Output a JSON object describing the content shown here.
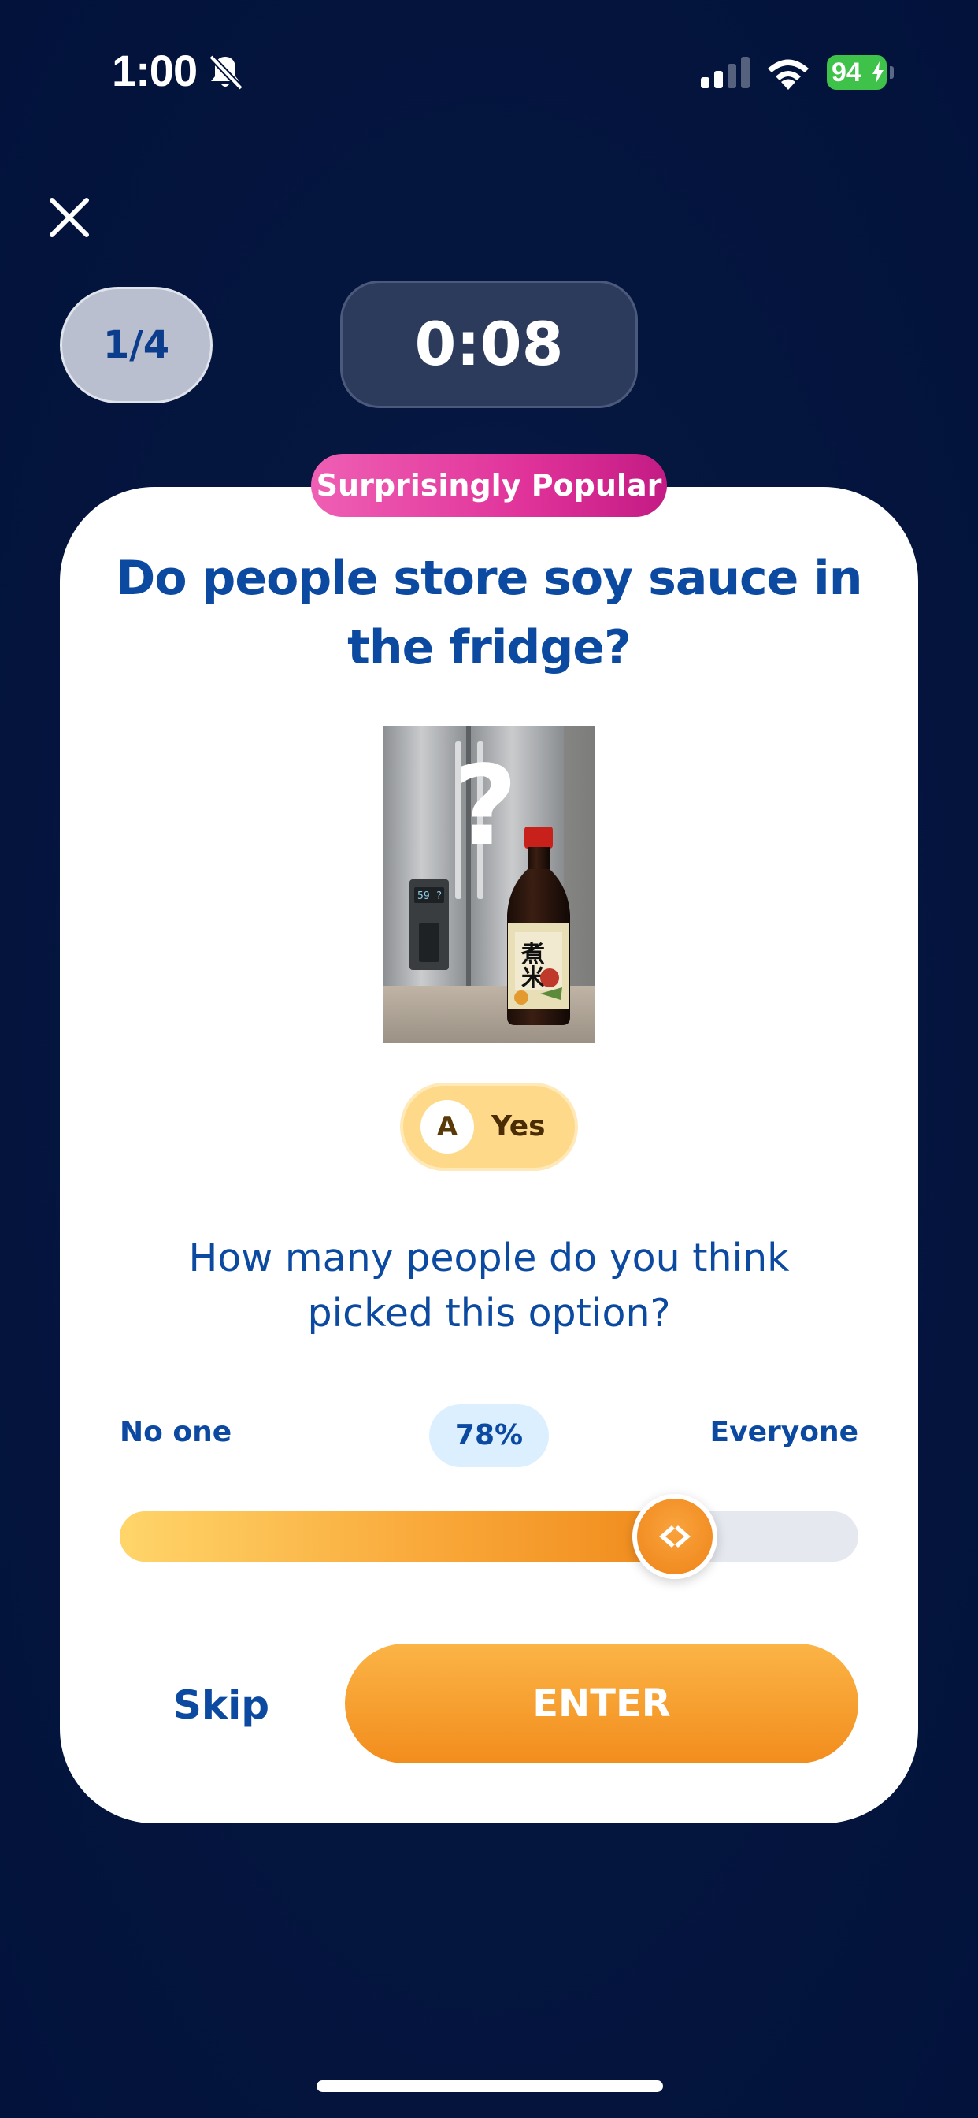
{
  "status_bar": {
    "time": "1:00",
    "battery_level": "94",
    "icons": [
      "bell-slash-icon",
      "cellular-signal-icon",
      "wifi-icon",
      "battery-charging-icon"
    ]
  },
  "header": {
    "close_icon": "close-icon",
    "progress": "1/4",
    "timer": "0:08"
  },
  "card": {
    "category": "Surprisingly Popular",
    "question": "Do people store soy sauce in the fridge?",
    "image_icon": "fridge-soy-sauce-photo",
    "option": {
      "letter": "A",
      "label": "Yes"
    },
    "prompt": "How many people do you think picked this option?",
    "slider": {
      "min_label": "No one",
      "max_label": "Everyone",
      "value_label": "78%",
      "value": 0.78
    },
    "skip_label": "Skip",
    "enter_label": "ENTER"
  },
  "colors": {
    "background": "#02123b",
    "accent_orange": "#f28d1d",
    "primary_blue": "#0b4aa0",
    "tag_pink": "#e0339a"
  }
}
